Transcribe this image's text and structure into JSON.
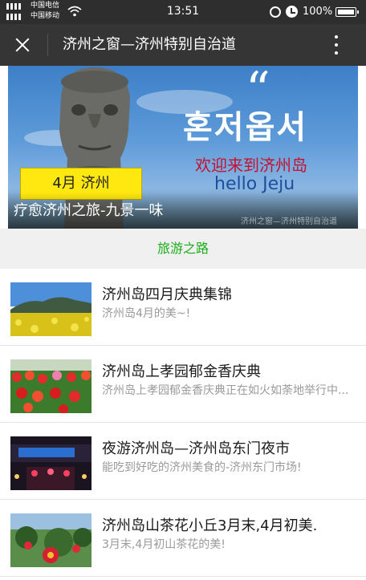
{
  "status_bar": {
    "carrier_1": "中国电信",
    "carrier_2": "中国移动",
    "time": "13:51",
    "battery": "100%"
  },
  "title_bar": {
    "title": "济州之窗—济州特别自治道"
  },
  "banner": {
    "quote_mark": "“",
    "korean_text": "혼저옵서",
    "welcome_text": "欢迎来到济州岛",
    "hello_text": "hello Jeju",
    "badge_text": "4月 济州",
    "caption": "疗愈济州之旅-九景一味",
    "watermark": "济州之窗—济州特别自治道"
  },
  "section": {
    "title": "旅游之路"
  },
  "articles": [
    {
      "title": "济州岛四月庆典集锦",
      "desc": "济州岛4月的美~!"
    },
    {
      "title": "济州岛上孝园郁金香庆典",
      "desc": "济州岛上孝园郁金香庆典正在如火如荼地举行中..."
    },
    {
      "title": "夜游济州岛—济州岛东门夜市",
      "desc": "能吃到好吃的济州美食的-济州东门市场!"
    },
    {
      "title": "济州岛山茶花小丘3月末,4月初美.",
      "desc": "3月末,4月初山茶花的美!"
    }
  ],
  "colors": {
    "status_bg": "#2e2e2e",
    "titlebar_bg": "#353535",
    "accent_green": "#1aad19",
    "desc_gray": "#9a9a9a"
  }
}
